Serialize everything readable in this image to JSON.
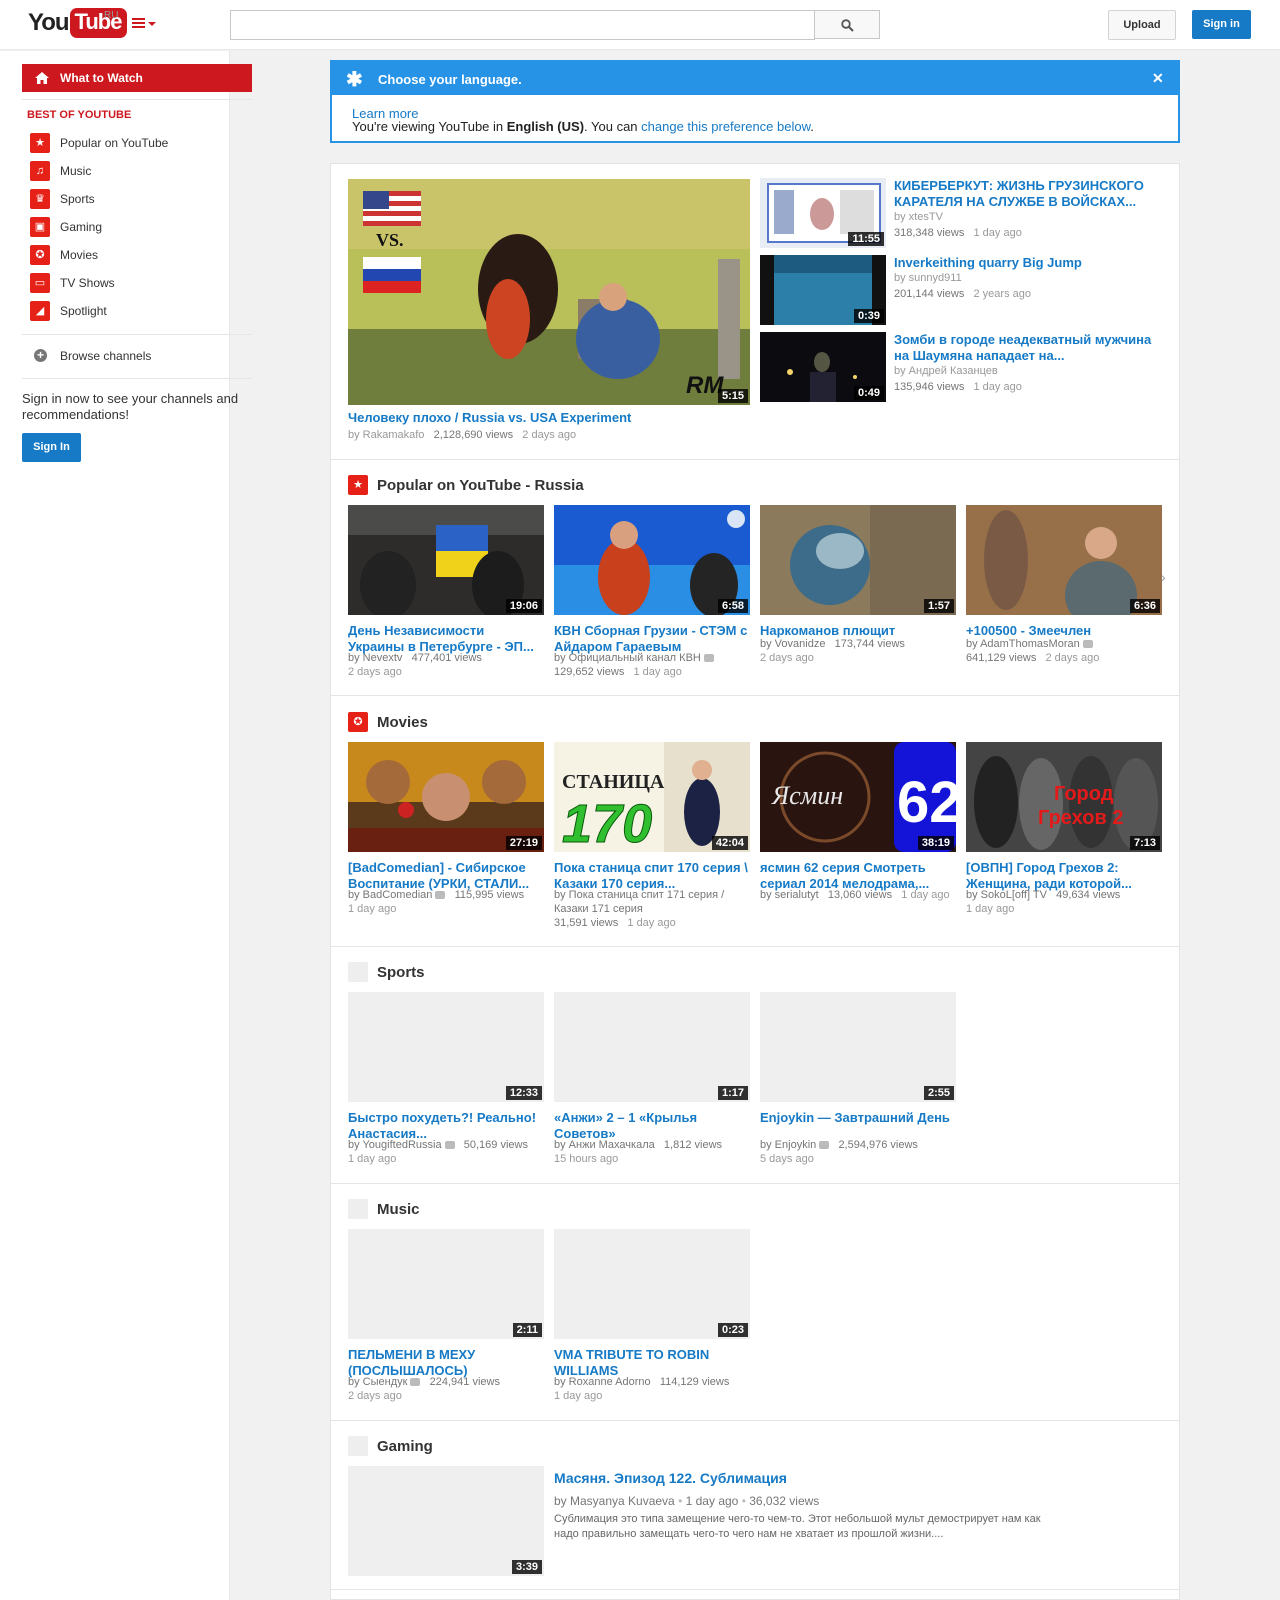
{
  "masthead": {
    "logo_you": "You",
    "logo_tube": "Tube",
    "region": "RU",
    "search_placeholder": "",
    "upload_label": "Upload",
    "signin_label": "Sign in"
  },
  "guide": {
    "what_to_watch": "What to Watch",
    "section_heading": "BEST OF YOUTUBE",
    "items": [
      {
        "label": "Popular on YouTube",
        "icon": "popular-icon"
      },
      {
        "label": "Music",
        "icon": "headphones-icon"
      },
      {
        "label": "Sports",
        "icon": "trophy-icon"
      },
      {
        "label": "Gaming",
        "icon": "gamepad-icon"
      },
      {
        "label": "Movies",
        "icon": "film-reel-icon"
      },
      {
        "label": "TV Shows",
        "icon": "tv-icon"
      },
      {
        "label": "Spotlight",
        "icon": "spotlight-icon"
      }
    ],
    "browse_channels": "Browse channels",
    "signin_message": "Sign in now to see your channels and recommendations!",
    "signin_button": "Sign In"
  },
  "language_banner": {
    "title": "Choose your language.",
    "learn_more": "Learn more",
    "viewing_prefix": "You're viewing YouTube in ",
    "language": "English (US)",
    "viewing_mid": ". You can ",
    "change_link": "change this preference below",
    "viewing_suffix": "."
  },
  "featured": {
    "main": {
      "title": "Человеку плохо / Russia vs. USA Experiment",
      "by": "by Rakamakafo",
      "views": "2,128,690 views",
      "age": "2 days ago",
      "duration": "5:15"
    },
    "side": [
      {
        "title": "КИБЕРБЕРКУТ: ЖИЗНЬ ГРУЗИНСКОГО КАРАТЕЛЯ НА СЛУЖБЕ В ВОЙСКАХ...",
        "by": "by xtesTV",
        "views": "318,348 views",
        "age": "1 day ago",
        "duration": "11:55"
      },
      {
        "title": "Inverkeithing quarry Big Jump",
        "by": "by sunnyd911",
        "views": "201,144 views",
        "age": "2 years ago",
        "duration": "0:39"
      },
      {
        "title": "Зомби в городе неадекватный мужчина на Шаумяна нападает на...",
        "by": "by Андрей Казанцев",
        "views": "135,946 views",
        "age": "1 day ago",
        "duration": "0:49"
      }
    ]
  },
  "shelves": {
    "popular": {
      "title": "Popular on YouTube - Russia",
      "items": [
        {
          "title": "День Независимости Украины в Петербурге - ЭП...",
          "by": "by Nevextv",
          "views": "477,401 views",
          "age": "2 days ago",
          "duration": "19:06"
        },
        {
          "title": "КВН Сборная Грузии - СТЭМ с Айдаром Гараевым",
          "by": "by Официальный канал КВН",
          "views": "129,652 views",
          "age": "1 day ago",
          "duration": "6:58"
        },
        {
          "title": "Наркоманов плющит",
          "by": "by Vovanidze",
          "views": "173,744 views",
          "age": "2 days ago",
          "duration": "1:57"
        },
        {
          "title": "+100500 - Змеечлен",
          "by": "by AdamThomasMoran",
          "views": "641,129 views",
          "age": "2 days ago",
          "duration": "6:36"
        }
      ]
    },
    "movies": {
      "title": "Movies",
      "items": [
        {
          "title": "[BadComedian] - Сибирское Воспитание (УРКИ, СТАЛИ...",
          "by": "by BadComedian",
          "views": "115,995 views",
          "age": "1 day ago",
          "duration": "27:19"
        },
        {
          "title": "Пока станица спит 170 серия \\ Казаки 170 серия...",
          "by": "by Пока станица спит 171 серия / Казаки 171 серия",
          "views": "31,591 views",
          "age": "1 day ago",
          "duration": "42:04"
        },
        {
          "title": "ясмин 62 серия Смотреть сериал 2014 мелодрама,...",
          "by": "by serialutyt",
          "views": "13,060 views",
          "age": "1 day ago",
          "duration": "38:19"
        },
        {
          "title": "[ОВПН] Город Грехов 2: Женщина, ради которой...",
          "by": "by SokoL[off] TV",
          "views": "49,634 views",
          "age": "1 day ago",
          "duration": "7:13"
        }
      ]
    },
    "sports": {
      "title": "Sports",
      "items": [
        {
          "title": "Быстро похудеть?! Реально! Анастасия...",
          "by": "by YougiftedRussia",
          "views": "50,169 views",
          "age": "1 day ago",
          "duration": "12:33"
        },
        {
          "title": "«Анжи» 2 – 1 «Крылья Советов»",
          "by": "by Анжи Махачкала",
          "views": "1,812 views",
          "age": "15 hours ago",
          "duration": "1:17"
        },
        {
          "title": "Enjoykin — Завтрашний День",
          "by": "by Enjoykin",
          "views": "2,594,976 views",
          "age": "5 days ago",
          "duration": "2:55"
        }
      ]
    },
    "music": {
      "title": "Music",
      "items": [
        {
          "title": "ПЕЛЬМЕНИ В МЕХУ (ПОСЛЫШАЛОСЬ)",
          "by": "by Сыендук",
          "views": "224,941 views",
          "age": "2 days ago",
          "duration": "2:11"
        },
        {
          "title": "VMA TRIBUTE TO ROBIN WILLIAMS",
          "by": "by Roxanne Adorno",
          "views": "114,129 views",
          "age": "1 day ago",
          "duration": "0:23"
        }
      ]
    },
    "gaming": {
      "title": "Gaming",
      "item": {
        "title": "Масяня. Эпизод 122. Сублимация",
        "by": "by Masyanya Kuvaeva",
        "age": "1 day ago",
        "views": "36,032 views",
        "description": "Сублимация это типа замещение чего-то чем-то. Этот небольшой мульт демострирует нам как надо правильно замещать чего-то чего нам не хватает из прошлой жизни....",
        "duration": "3:39"
      }
    }
  },
  "colors": {
    "brand_red": "#cc181e",
    "link_blue": "#167ac6",
    "banner_blue": "#2793e6"
  }
}
